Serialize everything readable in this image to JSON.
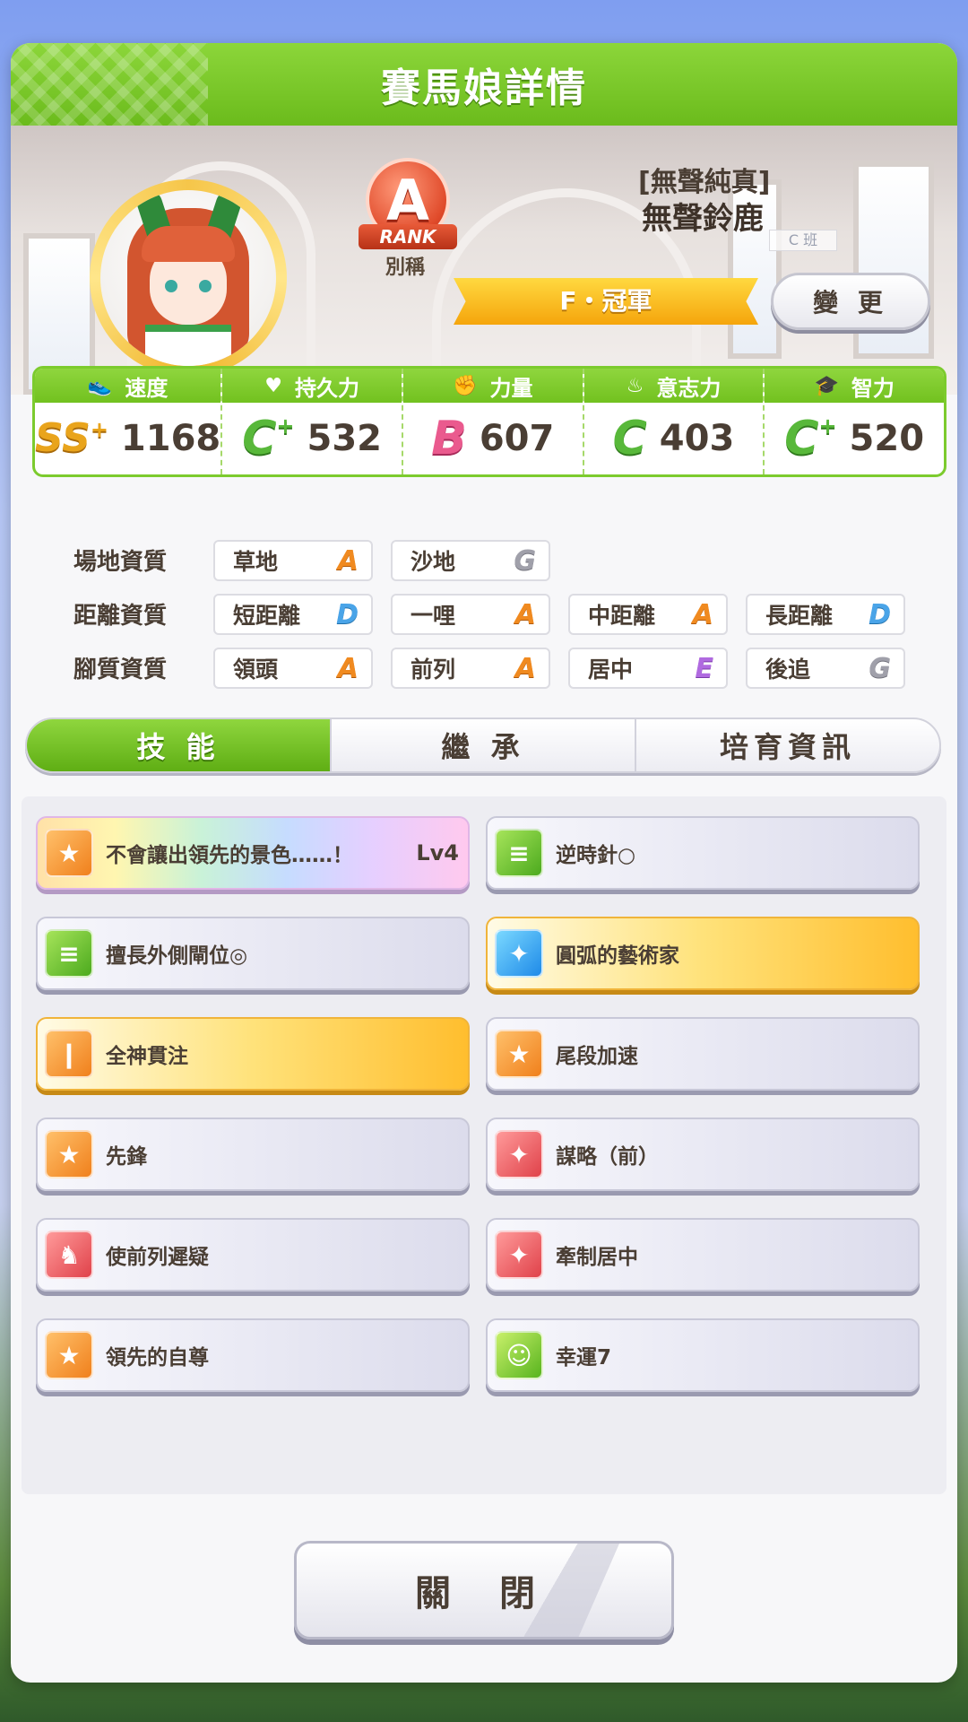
{
  "header": {
    "title": "賽馬娘詳情"
  },
  "profile": {
    "rank": "A",
    "rank_ribbon": "RANK",
    "nickname_label": "別稱",
    "epithet": "[無聲純真]",
    "name": "無聲鈴鹿",
    "class_tag": "C 班",
    "title": "F・冠軍",
    "change_button": "變 更"
  },
  "stats": [
    {
      "label": "速度",
      "icon": "shoe-icon",
      "grade": "SS",
      "plus": "+",
      "value": "1168"
    },
    {
      "label": "持久力",
      "icon": "heart-icon",
      "grade": "C",
      "plus": "+",
      "value": "532"
    },
    {
      "label": "力量",
      "icon": "muscle-icon",
      "grade": "B",
      "plus": "",
      "value": "607"
    },
    {
      "label": "意志力",
      "icon": "flame-icon",
      "grade": "C",
      "plus": "",
      "value": "403"
    },
    {
      "label": "智力",
      "icon": "grad-cap-icon",
      "grade": "C",
      "plus": "+",
      "value": "520"
    }
  ],
  "aptitude": {
    "track": {
      "label": "場地資質",
      "items": [
        {
          "name": "草地",
          "grade": "A"
        },
        {
          "name": "沙地",
          "grade": "G"
        }
      ]
    },
    "distance": {
      "label": "距離資質",
      "items": [
        {
          "name": "短距離",
          "grade": "D"
        },
        {
          "name": "一哩",
          "grade": "A"
        },
        {
          "name": "中距離",
          "grade": "A"
        },
        {
          "name": "長距離",
          "grade": "D"
        }
      ]
    },
    "style": {
      "label": "腳質資質",
      "items": [
        {
          "name": "領頭",
          "grade": "A"
        },
        {
          "name": "前列",
          "grade": "A"
        },
        {
          "name": "居中",
          "grade": "E"
        },
        {
          "name": "後追",
          "grade": "G"
        }
      ]
    }
  },
  "tabs": [
    {
      "label": "技 能",
      "active": true
    },
    {
      "label": "繼 承",
      "active": false
    },
    {
      "label": "培育資訊",
      "active": false
    }
  ],
  "skills": [
    {
      "name": "不會讓出領先的景色……！",
      "level": "Lv4",
      "style": "rainbow",
      "icon": "orange"
    },
    {
      "name": "逆時針○",
      "level": "",
      "style": "normal",
      "icon": "green"
    },
    {
      "name": "擅長外側閘位◎",
      "level": "",
      "style": "normal",
      "icon": "green"
    },
    {
      "name": "圓弧的藝術家",
      "level": "",
      "style": "gold",
      "icon": "blue"
    },
    {
      "name": "全神貫注",
      "level": "",
      "style": "gold",
      "icon": "orange"
    },
    {
      "name": "尾段加速",
      "level": "",
      "style": "normal",
      "icon": "orange"
    },
    {
      "name": "先鋒",
      "level": "",
      "style": "normal",
      "icon": "orange"
    },
    {
      "name": "謀略（前）",
      "level": "",
      "style": "normal",
      "icon": "red"
    },
    {
      "name": "使前列遲疑",
      "level": "",
      "style": "normal",
      "icon": "red"
    },
    {
      "name": "牽制居中",
      "level": "",
      "style": "normal",
      "icon": "red"
    },
    {
      "name": "領先的自尊",
      "level": "",
      "style": "normal",
      "icon": "orange"
    },
    {
      "name": "幸運7",
      "level": "",
      "style": "normal",
      "icon": "lime"
    }
  ],
  "close_button": "關 閉"
}
